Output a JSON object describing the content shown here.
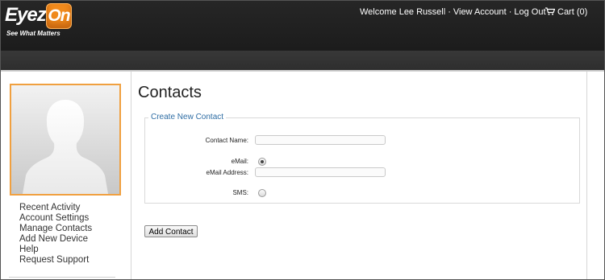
{
  "header": {
    "logo_text": "Eyez",
    "logo_badge": "On",
    "tagline": "See What Matters",
    "welcome": "Welcome Lee Russell",
    "separator": "·",
    "view_account": "View Account",
    "log_out": "Log Out",
    "cart": "Cart (0)"
  },
  "sidebar": {
    "items": [
      {
        "label": "Recent Activity"
      },
      {
        "label": "Account Settings"
      },
      {
        "label": "Manage Contacts"
      },
      {
        "label": "Add New Device"
      },
      {
        "label": "Help"
      },
      {
        "label": "Request Support"
      }
    ]
  },
  "main": {
    "title": "Contacts",
    "form": {
      "legend": "Create New Contact",
      "contact_name_label": "Contact Name:",
      "contact_name_value": "",
      "email_label": "eMail:",
      "email_selected": true,
      "email_address_label": "eMail Address:",
      "email_address_value": "",
      "sms_label": "SMS:",
      "sms_selected": false,
      "submit_label": "Add Contact"
    }
  },
  "colors": {
    "header_bg": "#262626",
    "accent_orange": "#f08a1c",
    "legend_blue": "#2e6da4"
  }
}
